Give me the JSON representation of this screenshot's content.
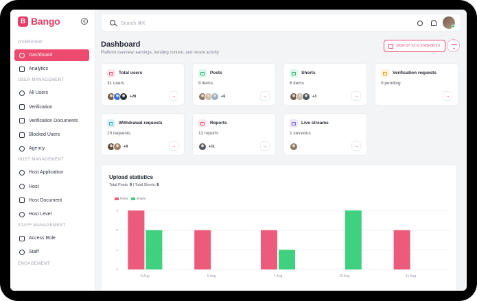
{
  "app": {
    "brand": "Bango",
    "logo_letter": "B"
  },
  "sidebar": {
    "sections": [
      {
        "title": "OVERVIEW",
        "items": [
          {
            "label": "Dashboard",
            "active": true,
            "icon": "user-icon"
          },
          {
            "label": "Analytics",
            "icon": "bar-chart-icon"
          }
        ]
      },
      {
        "title": "USER MANAGEMENT",
        "items": [
          {
            "label": "All Users",
            "icon": "users-icon"
          },
          {
            "label": "Verification",
            "icon": "shield-check-icon"
          },
          {
            "label": "Verification Documents",
            "icon": "document-icon"
          },
          {
            "label": "Blocked Users",
            "icon": "block-icon"
          },
          {
            "label": "Agency",
            "icon": "location-icon"
          }
        ]
      },
      {
        "title": "HOST MANAGEMENT",
        "items": [
          {
            "label": "Host Application",
            "icon": "user-icon"
          },
          {
            "label": "Host",
            "icon": "user-icon"
          },
          {
            "label": "Host Document",
            "icon": "document-icon"
          },
          {
            "label": "Host Level",
            "icon": "level-icon"
          }
        ]
      },
      {
        "title": "STAFF MANAGEMENT",
        "items": [
          {
            "label": "Access Role",
            "icon": "shield-icon"
          },
          {
            "label": "Staff",
            "icon": "user-icon"
          }
        ]
      },
      {
        "title": "ENGAGEMENT",
        "items": []
      }
    ]
  },
  "topbar": {
    "search_placeholder": "Search ⌘K"
  },
  "header": {
    "title": "Dashboard",
    "subtitle": "Platform overview, earnings, trending content, and recent activity",
    "date_range": "2026-07-13 to 2026-08-13"
  },
  "cards": [
    {
      "title": "Total users",
      "value": "31 users",
      "more": "+28",
      "icon": "users-icon",
      "color": "#ec4a6e",
      "bg": "#fde7ed",
      "avatars": [
        "#7b5a45",
        "#2f6fd6",
        "#24303d"
      ]
    },
    {
      "title": "Posts",
      "value": "9 items",
      "more": "+6",
      "icon": "image-icon",
      "color": "#22b573",
      "bg": "#def7ea",
      "avatars": [
        "#8a7866",
        "#cdbda5",
        "#9ab0c4"
      ]
    },
    {
      "title": "Shorts",
      "value": "6 items",
      "more": "+3",
      "icon": "video-icon",
      "color": "#22b573",
      "bg": "#def7ea",
      "avatars": [
        "#6f5d4c",
        "#c9b7a2",
        "#4a5560"
      ]
    },
    {
      "title": "Verification requests",
      "value": "0 pending",
      "more": "",
      "icon": "clock-icon",
      "color": "#e6a019",
      "bg": "#fdf1d9",
      "avatars": []
    },
    {
      "title": "Withdrawal requests",
      "value": "10 requests",
      "more": "+8",
      "icon": "wallet-icon",
      "color": "#2ea8c9",
      "bg": "#ddf2f8",
      "avatars": [
        "#5a4c40",
        "#9d7e62"
      ]
    },
    {
      "title": "Reports",
      "value": "12 reports",
      "more": "+11",
      "icon": "flag-icon",
      "color": "#ec4a6e",
      "bg": "#fde7ed",
      "avatars": [
        "#545a63"
      ]
    },
    {
      "title": "Live streams",
      "value": "1 sessions",
      "more": "",
      "icon": "broadcast-icon",
      "color": "#7c5cd6",
      "bg": "#ece6fb",
      "avatars": [
        "#8d7a62"
      ]
    }
  ],
  "chart": {
    "title": "Upload statistics",
    "total_posts_label": "Total Posts:",
    "total_posts": "9",
    "separator": "|",
    "total_shorts_label": "Total Shorts:",
    "total_shorts": "6"
  },
  "chart_data": {
    "type": "bar",
    "categories": [
      "5 Aug",
      "6 Aug",
      "7 Aug",
      "10 Aug",
      "11 Aug"
    ],
    "series": [
      {
        "name": "Posts",
        "values": [
          3,
          2,
          2,
          0,
          2
        ],
        "color": "#ec5a7c"
      },
      {
        "name": "Shorts",
        "values": [
          2,
          0,
          1,
          3,
          0
        ],
        "color": "#3fd17f"
      }
    ],
    "yticks": [
      0,
      1,
      2,
      3
    ],
    "ylim": [
      0,
      3
    ],
    "grid": true,
    "legend": "top-left"
  }
}
